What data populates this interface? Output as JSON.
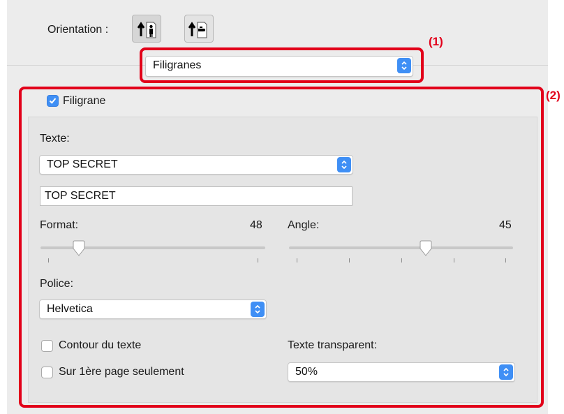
{
  "orientation": {
    "label": "Orientation :",
    "options": [
      "portrait-icon",
      "landscape-icon"
    ]
  },
  "panel_select": {
    "value": "Filigranes"
  },
  "watermark": {
    "checkbox_label": "Filigrane",
    "checked": true,
    "text_label": "Texte:",
    "text_select": "TOP SECRET",
    "text_field": "TOP SECRET",
    "format_label": "Format:",
    "format_value": "48",
    "angle_label": "Angle:",
    "angle_value": "45",
    "font_label": "Police:",
    "font_select": "Helvetica",
    "outline_label": "Contour du texte",
    "outline_checked": false,
    "first_page_label": "Sur 1ère page seulement",
    "first_page_checked": false,
    "transparent_label": "Texte transparent:",
    "transparent_select": "50%"
  },
  "callouts": {
    "one": "(1)",
    "two": "(2)"
  },
  "colors": {
    "accent": "#3f8ff5",
    "highlight": "#e2001a"
  }
}
